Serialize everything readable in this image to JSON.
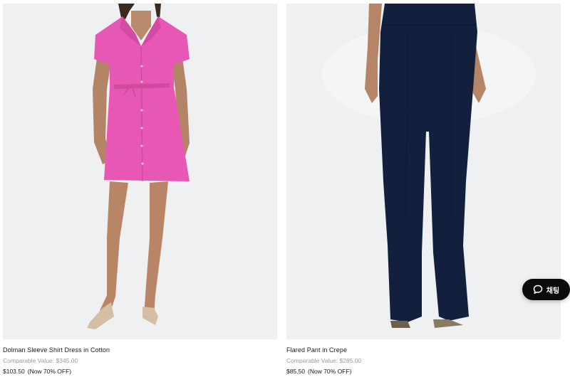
{
  "products": [
    {
      "name": "Dolman Sleeve Shirt Dress in Cotton",
      "comparable": "Comparable Value: $345.00",
      "price": "$103.50",
      "discount": "(Now 70% OFF)",
      "image": "pink-shirt-dress-photo",
      "color": "#e855b3"
    },
    {
      "name": "Flared Pant in Crepe",
      "comparable": "Comparable Value: $285.00",
      "price": "$85.50",
      "discount": "(Now 70% OFF)",
      "image": "navy-flared-pant-photo",
      "color": "#13203d"
    }
  ],
  "chat": {
    "label": "채팅",
    "icon": "chat-bubble-icon"
  }
}
